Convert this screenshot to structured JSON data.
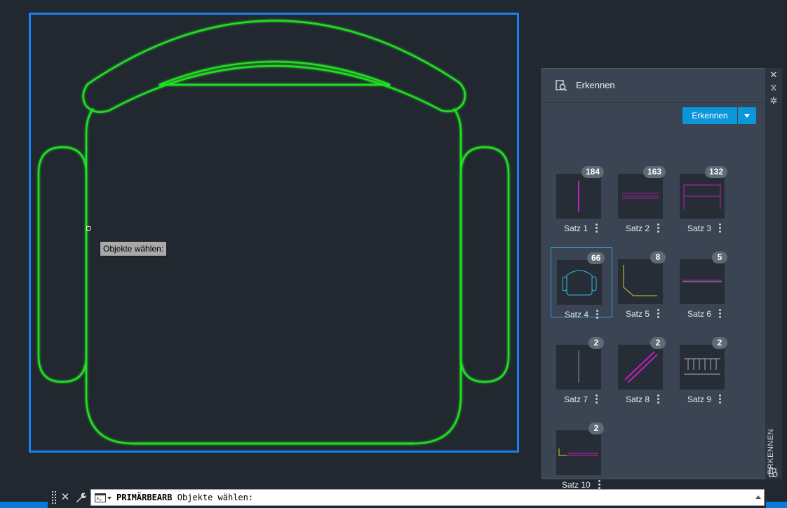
{
  "drawing": {
    "frame_color": "#1a7ff0",
    "geometry_color": "#22e022",
    "tooltip": "Objekte wählen:"
  },
  "palette": {
    "title": "Erkennen",
    "title_icon": "search-document-icon",
    "button_label": "Erkennen",
    "accent": "#0a96d8",
    "side_label": "ERKENNEN",
    "sets": [
      {
        "label": "Satz 1",
        "count": "184",
        "selected": false
      },
      {
        "label": "Satz 2",
        "count": "163",
        "selected": false
      },
      {
        "label": "Satz 3",
        "count": "132",
        "selected": false
      },
      {
        "label": "Satz 4",
        "count": "66",
        "selected": true
      },
      {
        "label": "Satz 5",
        "count": "8",
        "selected": false
      },
      {
        "label": "Satz 6",
        "count": "5",
        "selected": false
      },
      {
        "label": "Satz 7",
        "count": "2",
        "selected": false
      },
      {
        "label": "Satz 8",
        "count": "2",
        "selected": false
      },
      {
        "label": "Satz 9",
        "count": "2",
        "selected": false
      },
      {
        "label": "Satz 10",
        "count": "2",
        "selected": false
      }
    ]
  },
  "command_line": {
    "command": "PRIMÄRBEARB",
    "prompt": "Objekte wählen:"
  }
}
